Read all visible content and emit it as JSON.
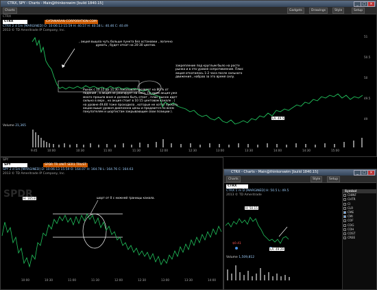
{
  "top_window": {
    "title": "CTRX, SPY - Charts - Main@thinkorswim [build 1840.15]",
    "toolbar": {
      "charts": "Charts",
      "gadgets": "Gadgets",
      "drawings": "Drawings",
      "style": "Style",
      "setup": "Setup"
    },
    "panel_label": "CTRX",
    "symbol": "CTRX",
    "symbol_desc": "CATAMARAN CORPORATION COM",
    "info_line": "CTRX 2 d 1m [MARGINED]  O: 10:06:13 15:59  H: 40.57  H: 40.58  L: 40.46  C: 40.49",
    "copyright": "2013 © TD Ameritrade IP Company, Inc.",
    "annotation_1": ", акция вышла чуть больше пункта без остановки , логично думать , будет откат на 20-30 центов.",
    "annotation_2": "Рынок с 10.15 до 11.30 показывает возврат на 80 % от падения , а акция не реагирует на него. По идее акция уже много прошла вниз и должен быть откат , плюс рынок идет сильно в верх , но акция стоит в 10 15 центовом канале . ( на уровне 49,60 тоже проходила , которые не хотят пускать акции выше уровня диапазона цены и продаются по всем покупателям и шортистам закрывающим свои позиции ).",
    "annotation_3": "закрепление под круглым было на росте рынка и в это уровне сопротивление. Плюс акция откатилась 1-2 часа после сильного движения , набрав за это время силу.",
    "price_label": "LA: 49.5",
    "y_ticks": [
      "51",
      "50.5",
      "50",
      "49.5",
      "49"
    ],
    "x_ticks": [
      "9:45",
      "10:00",
      "10:30",
      "11:00",
      "11:30",
      "12:00",
      "12:30",
      "13:00",
      "13:30",
      "14:00",
      "14:30",
      "15:00"
    ],
    "volume": {
      "label": "Volume",
      "value": "21,365"
    }
  },
  "spy_window": {
    "panel_label": "SPY",
    "symbol": "SPY",
    "symbol_desc": "SPDR TR UNIT SER1 TRUST",
    "info_line": "SPY 2 d 1m [MARGINED]  D: 10:06:13 15:59  O: 164.07  H: 164.78  L: 164.76  C: 164.63",
    "copyright": "2013 © TD Ameritrade IP Company, Inc.",
    "annotation": "шорт от 0 с нижней границы канала.",
    "price_label": "H: 165.8",
    "watermark": "SPDR",
    "x_ticks": [
      "10:00",
      "10:30",
      "11:00",
      "11:30",
      "12:00",
      "12:30",
      "13:00",
      "13:30",
      "14:00"
    ]
  },
  "bottom_right_window": {
    "title": "CTRX - Charts - Main@thinkorswim [build 1840.15]",
    "toolbar": {
      "charts": "Charts",
      "style": "Style",
      "setup": "Setup"
    },
    "symbol": "CTRX",
    "info_line": "CTRX 1 m D [MARGINED]  H: 50.5  L: 49.5",
    "copyright": "2013 © TD Ameritrade",
    "price_labels": {
      "top": "H: 50.15",
      "bottom": "LA: 49.29",
      "marker": "$0.41"
    },
    "volume": {
      "label": "Volume",
      "value": "1,509,812"
    },
    "watchlist_header": "Symbol",
    "watchlist": [
      "CHINF",
      "CHTR",
      "CI",
      "CLR",
      "CME",
      "CMI",
      "COF",
      "COG",
      "COH",
      "COST",
      "CREE"
    ],
    "watchlist_selected": [
      "CME",
      "CMI"
    ]
  }
}
